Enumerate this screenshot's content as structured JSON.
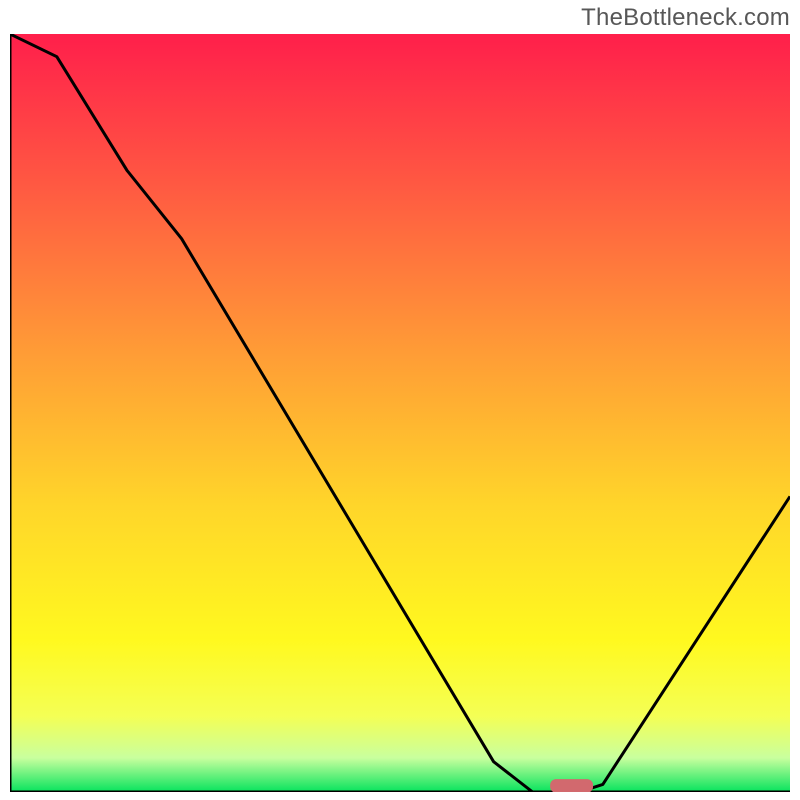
{
  "watermark": "TheBottleneck.com",
  "chart_data": {
    "type": "line",
    "title": "",
    "xlabel": "",
    "ylabel": "",
    "xlim": [
      0,
      100
    ],
    "ylim": [
      0,
      100
    ],
    "series": [
      {
        "name": "curve",
        "x": [
          0,
          6,
          15,
          22,
          62,
          67,
          73,
          76,
          100
        ],
        "y": [
          100,
          97,
          82,
          73,
          4,
          0,
          0,
          1,
          39
        ]
      }
    ],
    "marker": {
      "x": 72,
      "y": 0.8,
      "w": 5.5,
      "h": 1.8
    },
    "gradient_stops": [
      {
        "offset": 0.0,
        "color": "#ff1f4b"
      },
      {
        "offset": 0.2,
        "color": "#ff5942"
      },
      {
        "offset": 0.42,
        "color": "#ff9c36"
      },
      {
        "offset": 0.62,
        "color": "#ffd52a"
      },
      {
        "offset": 0.8,
        "color": "#fff91f"
      },
      {
        "offset": 0.9,
        "color": "#f4ff55"
      },
      {
        "offset": 0.955,
        "color": "#c9ff9e"
      },
      {
        "offset": 1.0,
        "color": "#07e35d"
      }
    ],
    "axis_color": "#000000",
    "curve_color": "#000000",
    "marker_color": "#d2696e"
  }
}
